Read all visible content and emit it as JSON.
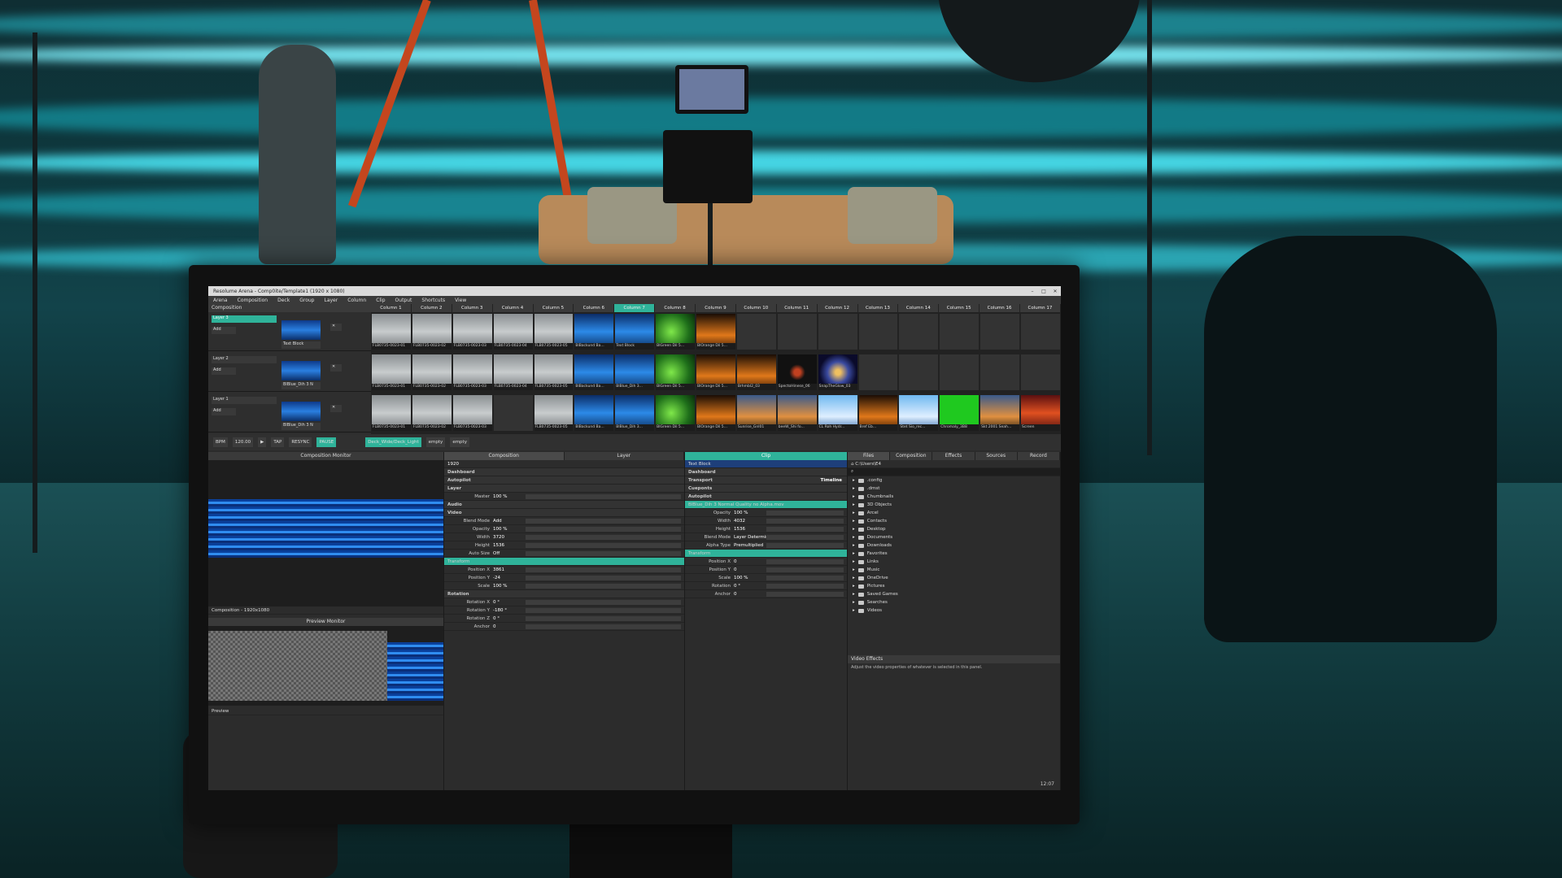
{
  "window": {
    "title": "Resolume Arena - Comp0ite/Template1 (1920 x 1080)",
    "controls": [
      "–",
      "□",
      "✕"
    ]
  },
  "menu": [
    "Arena",
    "Composition",
    "Deck",
    "Group",
    "Layer",
    "Column",
    "Clip",
    "Output",
    "Shortcuts",
    "View"
  ],
  "composition_label": "Composition",
  "columns": [
    "Column 1",
    "Column 2",
    "Column 3",
    "Column 4",
    "Column 5",
    "Column 6",
    "Column 7",
    "Column 8",
    "Column 9",
    "Column 10",
    "Column 11",
    "Column 12",
    "Column 13",
    "Column 14",
    "Column 15",
    "Column 16",
    "Column 17"
  ],
  "layers": [
    {
      "name": "Layer 3",
      "clip_label": "Text Block",
      "blend": "Add"
    },
    {
      "name": "Layer 2",
      "clip_label": "BlBlue_Dih 3 N",
      "blend": "Add"
    },
    {
      "name": "Layer 1",
      "clip_label": "BlBlue_Dih 3 N",
      "blend": "Add"
    }
  ],
  "clip_rows": [
    {
      "clips": [
        {
          "style": "gray",
          "label": "FLB0735-0023-01"
        },
        {
          "style": "gray",
          "label": "FLB0735-0023-02"
        },
        {
          "style": "gray",
          "label": "FLB0735-0023-03"
        },
        {
          "style": "gray",
          "label": "FLB0735-0023-04"
        },
        {
          "style": "gray",
          "label": "FLB0735-0023-05"
        },
        {
          "style": "blue",
          "label": "BlBackund Ba..."
        },
        {
          "style": "blue",
          "label": "Text Block"
        },
        {
          "style": "green",
          "label": "BlGreen Dil 5..."
        },
        {
          "style": "fire",
          "label": "BlOrange Dil 5..."
        },
        {
          "style": "empty",
          "label": ""
        },
        {
          "style": "empty",
          "label": ""
        },
        {
          "style": "empty",
          "label": ""
        },
        {
          "style": "empty",
          "label": ""
        },
        {
          "style": "empty",
          "label": ""
        },
        {
          "style": "empty",
          "label": ""
        },
        {
          "style": "empty",
          "label": ""
        },
        {
          "style": "empty",
          "label": ""
        }
      ]
    },
    {
      "clips": [
        {
          "style": "gray",
          "label": "FLB0735-0023-01"
        },
        {
          "style": "gray",
          "label": "FLB0735-0023-02"
        },
        {
          "style": "gray",
          "label": "FLB0735-0023-03"
        },
        {
          "style": "gray",
          "label": "FLB0735-0023-04"
        },
        {
          "style": "gray",
          "label": "FLB0735-0023-05"
        },
        {
          "style": "blue",
          "label": "BlBackund Ba..."
        },
        {
          "style": "blue",
          "label": "BlBlue_Dih 3..."
        },
        {
          "style": "green",
          "label": "BlGreen Dil 5..."
        },
        {
          "style": "fire",
          "label": "BlOrange Dil 5..."
        },
        {
          "style": "fire",
          "label": "Brhmbl2_03"
        },
        {
          "style": "fig",
          "label": "SpectoHinese_06"
        },
        {
          "style": "star",
          "label": "SnapTheGlow_03"
        },
        {
          "style": "empty",
          "label": ""
        },
        {
          "style": "empty",
          "label": ""
        },
        {
          "style": "empty",
          "label": ""
        },
        {
          "style": "empty",
          "label": ""
        },
        {
          "style": "empty",
          "label": ""
        }
      ]
    },
    {
      "clips": [
        {
          "style": "gray",
          "label": "FLB0735-0023-01"
        },
        {
          "style": "gray",
          "label": "FLB0735-0023-02"
        },
        {
          "style": "gray",
          "label": "FLB0735-0023-03"
        },
        {
          "style": "empty",
          "label": ""
        },
        {
          "style": "gray",
          "label": "FLB0735-0023-05"
        },
        {
          "style": "blue",
          "label": "BlBackund Ba..."
        },
        {
          "style": "blue",
          "label": "BlBlue_Dih 3..."
        },
        {
          "style": "green",
          "label": "BlGreen Dil 5..."
        },
        {
          "style": "fire",
          "label": "BlOrange Dil 5..."
        },
        {
          "style": "sunset",
          "label": "Sunrise_Gnl01"
        },
        {
          "style": "sunset",
          "label": "beeW_Shi fo..."
        },
        {
          "style": "sky",
          "label": "CL Roh Hydr..."
        },
        {
          "style": "fire",
          "label": "Bref Eb..."
        },
        {
          "style": "sky",
          "label": "Stet Sio_rec..."
        },
        {
          "style": "solid",
          "label": "Chromaly_3B8"
        },
        {
          "style": "sunset",
          "label": "Skt 2001 Seah..."
        },
        {
          "style": "red",
          "label": "Screen"
        }
      ]
    }
  ],
  "transport": {
    "bpm_label": "BPM",
    "bpm_value": "120.00",
    "buttons": [
      "TAP",
      "RESYNC",
      "PAUSE"
    ],
    "deck_tabs": [
      "Deck_Wide/Deck_Light",
      "empty",
      "empty"
    ]
  },
  "composition_monitor": {
    "title": "Composition Monitor",
    "footer": "Composition - 1920x1080",
    "preview_title": "Preview Monitor",
    "preview_footer": "Preview"
  },
  "composition_panel": {
    "tabs": [
      "Composition",
      "Layer"
    ],
    "field_value": "1920",
    "rows": [
      {
        "type": "sect",
        "k": "Dashboard",
        "v": ""
      },
      {
        "type": "sect",
        "k": "Autopilot",
        "v": ""
      },
      {
        "type": "sect",
        "k": "Layer",
        "v": ""
      },
      {
        "type": "row",
        "k": "Master",
        "v": "100 %"
      },
      {
        "type": "sect",
        "k": "Audio",
        "v": ""
      },
      {
        "type": "sect",
        "k": "Video",
        "v": ""
      },
      {
        "type": "row",
        "k": "Blend Mode",
        "v": "Add"
      },
      {
        "type": "row",
        "k": "Opacity",
        "v": "100 %"
      },
      {
        "type": "row",
        "k": "Width",
        "v": "3720"
      },
      {
        "type": "row",
        "k": "Height",
        "v": "1536"
      },
      {
        "type": "row",
        "k": "Auto Size",
        "v": "Off"
      },
      {
        "type": "grn",
        "k": "Transform",
        "v": ""
      },
      {
        "type": "row",
        "k": "Position X",
        "v": "3861"
      },
      {
        "type": "row",
        "k": "Position Y",
        "v": "-24"
      },
      {
        "type": "row",
        "k": "Scale",
        "v": "100 %"
      },
      {
        "type": "sect",
        "k": "Rotation",
        "v": ""
      },
      {
        "type": "row",
        "k": "Rotation X",
        "v": "0 °"
      },
      {
        "type": "row",
        "k": "Rotation Y",
        "v": "-180 °"
      },
      {
        "type": "row",
        "k": "Rotation Z",
        "v": "0 °"
      },
      {
        "type": "row",
        "k": "Anchor",
        "v": "0"
      }
    ]
  },
  "clip_panel": {
    "title": "Clip",
    "selected": "Text Block",
    "rows": [
      {
        "type": "sect",
        "k": "Dashboard",
        "v": ""
      },
      {
        "type": "sect",
        "k": "Transport",
        "v": "Timeline"
      },
      {
        "type": "sect",
        "k": "Cueponts",
        "v": ""
      },
      {
        "type": "sect",
        "k": "Autopilot",
        "v": ""
      },
      {
        "type": "grn",
        "k": "BlBlue_Dih 3 Normal Quality no Alpha.mov",
        "v": ""
      },
      {
        "type": "row",
        "k": "Opacity",
        "v": "100 %"
      },
      {
        "type": "row",
        "k": "Width",
        "v": "4032"
      },
      {
        "type": "row",
        "k": "Height",
        "v": "1536"
      },
      {
        "type": "row",
        "k": "Blend Mode",
        "v": "Layer Determined"
      },
      {
        "type": "row",
        "k": "Alpha Type",
        "v": "Premultiplied"
      },
      {
        "type": "grn",
        "k": "Transform",
        "v": ""
      },
      {
        "type": "row",
        "k": "Position X",
        "v": "0"
      },
      {
        "type": "row",
        "k": "Position Y",
        "v": "0"
      },
      {
        "type": "row",
        "k": "Scale",
        "v": "100 %"
      },
      {
        "type": "row",
        "k": "Rotation",
        "v": "0 °"
      },
      {
        "type": "row",
        "k": "Anchor",
        "v": "0"
      }
    ]
  },
  "browser": {
    "tabs": [
      "Files",
      "Composition",
      "Effects",
      "Sources",
      "Record"
    ],
    "path": "C:\\Users\\E4",
    "items": [
      ".config",
      ".dmst",
      "Chumbnails",
      "3D Objects",
      "Arcel",
      "Contacts",
      "Desktop",
      "Documents",
      "Downloads",
      "Favorites",
      "Links",
      "Music",
      "OneDrive",
      "Pictures",
      "Saved Games",
      "Searches",
      "Videos"
    ],
    "footer_title": "Video Effects",
    "footer_text": "Adjust the video properties of whatever is selected in this panel."
  },
  "clock": "12:07",
  "colors": {
    "accent": "#2fb39a",
    "panel": "#2c2c2c",
    "wall_glow": "#27d4e0"
  }
}
